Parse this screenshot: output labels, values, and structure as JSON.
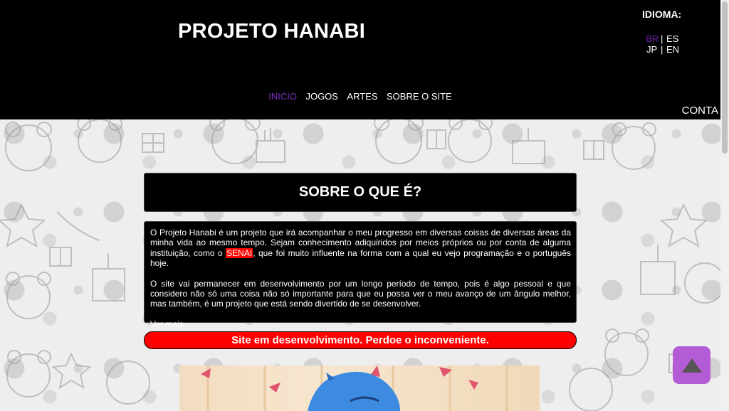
{
  "header": {
    "site_title": "PROJETO HANABI",
    "language_title": "IDIOMA:",
    "languages": [
      {
        "code": "BR",
        "active": true
      },
      {
        "code": "ES",
        "active": false
      },
      {
        "code": "JP",
        "active": false
      },
      {
        "code": "EN",
        "active": false
      }
    ],
    "separator": "|",
    "nav": [
      {
        "label": "INICIO",
        "active": true
      },
      {
        "label": "JOGOS",
        "active": false
      },
      {
        "label": "ARTES",
        "active": false
      },
      {
        "label": "SOBRE O SITE",
        "active": false
      }
    ],
    "account_label": "CONTA"
  },
  "main": {
    "section_title": "SOBRE O QUE É?",
    "paragraph1_before": "O Projeto Hanabi é um projeto que irá acompanhar o meu progresso em diversas coisas de diversas áreas da minha vida ao mesmo tempo. Sejam conhecimento adiquiridos por meios próprios ou por conta de alguma instituição, como o ",
    "paragraph1_highlight": "SENAI",
    "paragraph1_after": ", que foi muito influente na forma com a qual eu vejo programação e o português hoje.",
    "paragraph2": "O site vai permanecer em desenvolvimento por um longo período de tempo, pois é algo pessoal e que considero não só uma coisa não só importante para que eu possa ver o meu avanço de um ângulo melhor, mas também, é um projeto que está sendo divertido de se desenvolver.",
    "read_more": "Ver mais.",
    "dev_banner": "Site em desenvolvimento. Perdoe o inconveniente."
  },
  "colors": {
    "header_bg": "#000000",
    "active_link": "#7b2fbf",
    "highlight": "#ff0000",
    "scroll_top_button": "#b45bd6"
  },
  "icons": {
    "scroll_top": "triangle-up-icon"
  }
}
